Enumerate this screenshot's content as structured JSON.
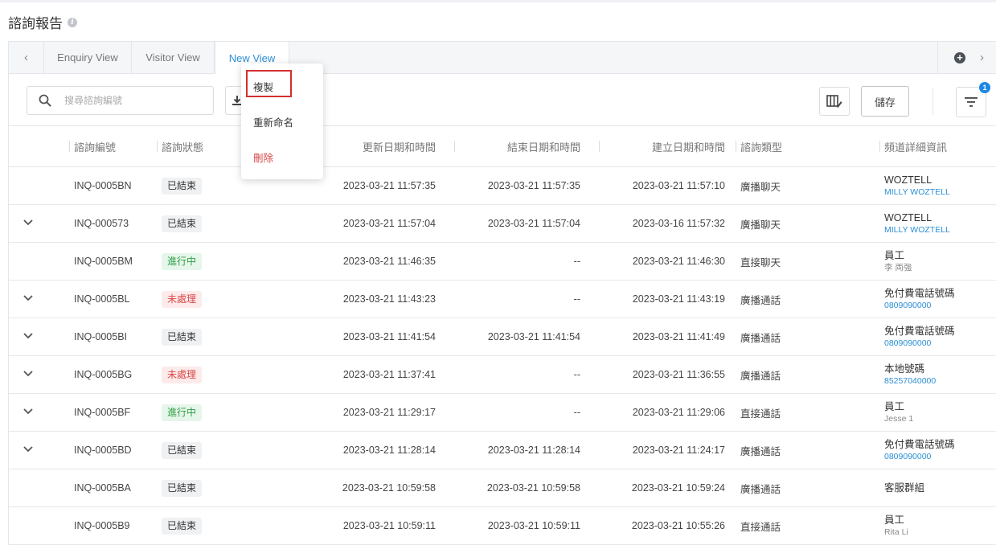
{
  "page": {
    "title": "諮詢報告"
  },
  "tabs": {
    "items": [
      {
        "label": "Enquiry View",
        "active": false
      },
      {
        "label": "Visitor View",
        "active": false
      },
      {
        "label": "New View",
        "active": true
      }
    ]
  },
  "toolbar": {
    "search_placeholder": "搜尋諮詢編號",
    "save_label": "儲存",
    "filter_badge": "1"
  },
  "menu": {
    "copy": "複製",
    "rename": "重新命名",
    "delete": "刪除"
  },
  "table": {
    "headers": {
      "id": "諮詢編號",
      "status": "諮詢狀態",
      "updated": "更新日期和時間",
      "ended": "結束日期和時間",
      "created": "建立日期和時間",
      "type": "諮詢類型",
      "channel": "頻道詳細資訊"
    },
    "rows": [
      {
        "expand": false,
        "id": "INQ-0005BN",
        "status": "已結束",
        "status_kind": "closed",
        "updated": "2023-03-21 11:57:35",
        "ended": "2023-03-21 11:57:35",
        "created": "2023-03-21 11:57:10",
        "type": "廣播聊天",
        "channel": "WOZTELL",
        "channel_sub": "MILLY WOZTELL",
        "sub_kind": "link"
      },
      {
        "expand": true,
        "id": "INQ-000573",
        "status": "已結束",
        "status_kind": "closed",
        "updated": "2023-03-21 11:57:04",
        "ended": "2023-03-21 11:57:04",
        "created": "2023-03-16 11:57:32",
        "type": "廣播聊天",
        "channel": "WOZTELL",
        "channel_sub": "MILLY WOZTELL",
        "sub_kind": "link"
      },
      {
        "expand": false,
        "id": "INQ-0005BM",
        "status": "進行中",
        "status_kind": "active",
        "updated": "2023-03-21 11:46:35",
        "ended": "--",
        "created": "2023-03-21 11:46:30",
        "type": "直接聊天",
        "channel": "員工",
        "channel_sub": "李 両強",
        "sub_kind": "gray"
      },
      {
        "expand": true,
        "id": "INQ-0005BL",
        "status": "未處理",
        "status_kind": "pending",
        "updated": "2023-03-21 11:43:23",
        "ended": "--",
        "created": "2023-03-21 11:43:19",
        "type": "廣播通話",
        "channel": "免付費電話號碼",
        "channel_sub": "0809090000",
        "sub_kind": "link"
      },
      {
        "expand": true,
        "id": "INQ-0005BI",
        "status": "已結束",
        "status_kind": "closed",
        "updated": "2023-03-21 11:41:54",
        "ended": "2023-03-21 11:41:54",
        "created": "2023-03-21 11:41:49",
        "type": "廣播通話",
        "channel": "免付費電話號碼",
        "channel_sub": "0809090000",
        "sub_kind": "link"
      },
      {
        "expand": true,
        "id": "INQ-0005BG",
        "status": "未處理",
        "status_kind": "pending",
        "updated": "2023-03-21 11:37:41",
        "ended": "--",
        "created": "2023-03-21 11:36:55",
        "type": "廣播通話",
        "channel": "本地號碼",
        "channel_sub": "85257040000",
        "sub_kind": "link"
      },
      {
        "expand": true,
        "id": "INQ-0005BF",
        "status": "進行中",
        "status_kind": "active",
        "updated": "2023-03-21 11:29:17",
        "ended": "--",
        "created": "2023-03-21 11:29:06",
        "type": "直接通話",
        "channel": "員工",
        "channel_sub": "Jesse 1",
        "sub_kind": "gray"
      },
      {
        "expand": true,
        "id": "INQ-0005BD",
        "status": "已結束",
        "status_kind": "closed",
        "updated": "2023-03-21 11:28:14",
        "ended": "2023-03-21 11:28:14",
        "created": "2023-03-21 11:24:17",
        "type": "廣播通話",
        "channel": "免付費電話號碼",
        "channel_sub": "0809090000",
        "sub_kind": "link"
      },
      {
        "expand": false,
        "id": "INQ-0005BA",
        "status": "已結束",
        "status_kind": "closed",
        "updated": "2023-03-21 10:59:58",
        "ended": "2023-03-21 10:59:58",
        "created": "2023-03-21 10:59:24",
        "type": "廣播通話",
        "channel": "客服群組",
        "channel_sub": "",
        "sub_kind": "none"
      },
      {
        "expand": false,
        "id": "INQ-0005B9",
        "status": "已結束",
        "status_kind": "closed",
        "updated": "2023-03-21 10:59:11",
        "ended": "2023-03-21 10:59:11",
        "created": "2023-03-21 10:55:26",
        "type": "直接通話",
        "channel": "員工",
        "channel_sub": "Rita Li",
        "sub_kind": "gray"
      }
    ]
  }
}
